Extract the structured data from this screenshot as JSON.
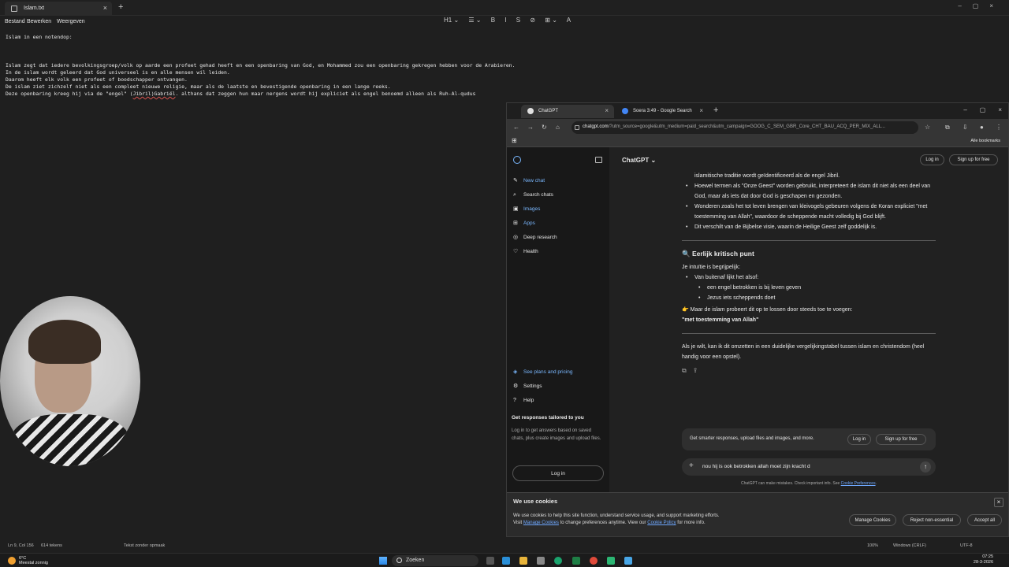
{
  "notepad": {
    "tab_title": "Islam.txt",
    "menu": [
      "Bestand",
      "Bewerken",
      "Weergeven"
    ],
    "toolbar": [
      "H1 ⌄",
      "☰ ⌄",
      "B",
      "I",
      "S",
      "⊘",
      "⊞ ⌄",
      "A"
    ],
    "lines": [
      "Islam in een notendop:",
      "",
      "",
      "",
      "Islam zegt dat iedere bevolkingsgroep/volk op aarde een profeet gehad heeft en een openbaring van God, en Mohammed zou een openbaring gekregen hebben voor de Arabieren.",
      "In de islam wordt geleerd dat God universeel is en alle mensen wil leiden.",
      "Daarom heeft elk volk een profeet of boodschapper ontvangen.",
      "De islam ziet zichzelf niet als een compleet nieuwe religie, maar als de laatste en bevestigende openbaring in een lange reeks."
    ],
    "last_line_start": "Deze openbaring kreeg hij via de \"engel\" (",
    "last_line_spell": "Jibril)Gabriël",
    "last_line_end": ". althans dat zeggen hun maar nergens wordt hij expliciet als engel benoemd alleen als Ruh-Al-qudus",
    "status": {
      "position": "Ln 9, Col 156",
      "chars": "614 tekens",
      "format": "Tekst zonder opmaak",
      "zoom": "100%",
      "line_ending": "Windows (CRLF)",
      "encoding": "UTF-8"
    }
  },
  "taskbar": {
    "temp": "6°C",
    "weather": "Meestal zonnig",
    "search": "Zoeken",
    "time": "07:25",
    "date": "28-3-2026"
  },
  "browser": {
    "tabs": [
      {
        "label": "ChatGPT",
        "color": "#e0e0e0"
      },
      {
        "label": "Soera 3:49 - Google Search",
        "color": "#4285f4"
      }
    ],
    "url_host": "chatgpt.com",
    "url_rest": "/?utm_source=google&utm_medium=paid_search&utm_campaign=GOOG_C_SEM_GBR_Core_CHT_BAU_ACQ_PER_MIX_ALL...",
    "bookmarks_label": "Alle bookmarks"
  },
  "sidebar": {
    "items": [
      {
        "label": "New chat",
        "icon": "✎",
        "color": "#7ab8ff"
      },
      {
        "label": "Search chats",
        "icon": "⌕",
        "color": "#e6e6e6"
      },
      {
        "label": "Images",
        "icon": "▣",
        "color": "#7ab8ff"
      },
      {
        "label": "Apps",
        "icon": "⊞",
        "color": "#7ab8ff"
      },
      {
        "label": "Deep research",
        "icon": "◎",
        "color": "#e6e6e6"
      },
      {
        "label": "Health",
        "icon": "♡",
        "color": "#e6e6e6"
      }
    ],
    "bottom": [
      {
        "label": "See plans and pricing",
        "icon": "◈",
        "color": "#7ab8ff"
      },
      {
        "label": "Settings",
        "icon": "⚙",
        "color": "#e6e6e6"
      },
      {
        "label": "Help",
        "icon": "?",
        "color": "#e6e6e6"
      }
    ],
    "promo_title": "Get responses tailored to you",
    "promo_text": "Log in to get answers based on saved chats, plus create images and upload files.",
    "login": "Log in"
  },
  "header": {
    "title": "ChatGPT ⌄",
    "login": "Log in",
    "signup": "Sign up for free"
  },
  "chat": {
    "partial_top": "islamitische traditie wordt geïdentificeerd als de engel Jibril.",
    "bullets": [
      "Hoewel termen als \"Onze Geest\" worden gebruikt, interpreteert de islam dit niet als een deel van God, maar als iets dat door God is geschapen en gezonden.",
      "Wonderen zoals het tot leven brengen van kleivogels gebeuren volgens de Koran expliciet \"met toestemming van Allah\", waardoor de scheppende macht volledig bij God blijft.",
      "Dit verschilt van de Bijbelse visie, waarin de Heilige Geest zelf goddelijk is."
    ],
    "heading": "🔍 Eerlijk kritisch punt",
    "intro": "Je intuïtie is begrijpelijk:",
    "outer_bullet": "Van buitenaf lijkt het alsof:",
    "sub_bullets": [
      "een engel betrokken is bij leven geven",
      "Jezus iets scheppends doet"
    ],
    "point": "👉 Maar de islam probeert dit op te lossen door steeds toe te voegen:",
    "quote": "\"met toestemming van Allah\"",
    "closing": "Als je wilt, kan ik dit omzetten in een duidelijke vergelijkingstabel tussen islam en christendom (heel handig voor een opstel)."
  },
  "banner": {
    "text": "Get smarter responses, upload files and images, and more.",
    "login": "Log in",
    "signup": "Sign up for free"
  },
  "composer": {
    "value": "nou hij is ook betrokken allah moet zijn kracht d"
  },
  "disclaimer": {
    "text": "ChatGPT can make mistakes. Check important info. See ",
    "link": "Cookie Preferences"
  },
  "cookie": {
    "title": "We use cookies",
    "line1": "We use cookies to help this site function, understand service usage, and support marketing efforts.",
    "visit": "Visit ",
    "manage_link": "Manage Cookies",
    "mid": " to change preferences anytime. View our ",
    "policy_link": "Cookie Policy",
    "end": " for more info.",
    "manage_btn": "Manage Cookies",
    "reject_btn": "Reject non-essential",
    "accept_btn": "Accept all"
  }
}
